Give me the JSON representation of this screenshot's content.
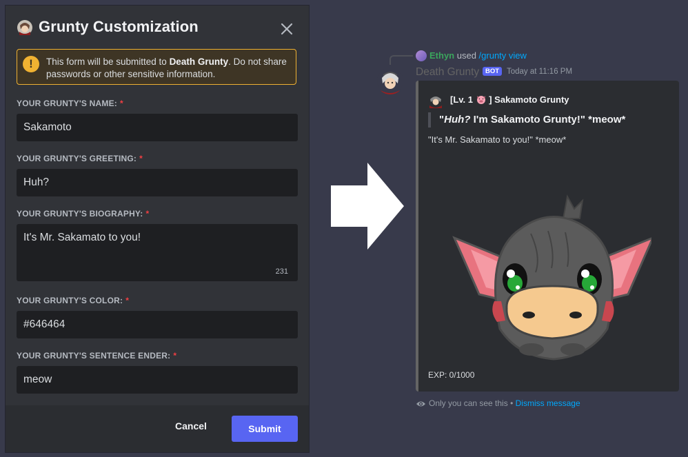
{
  "modal": {
    "title": "Grunty Customization",
    "warning_prefix": "This form will be submitted to ",
    "warning_bot": "Death Grunty",
    "warning_suffix": ". Do not share passwords or other sensitive information.",
    "fields": [
      {
        "label": "YOUR GRUNTY'S NAME:",
        "value": "Sakamoto"
      },
      {
        "label": "YOUR GRUNTY'S GREETING:",
        "value": "Huh?"
      },
      {
        "label": "YOUR GRUNTY'S BIOGRAPHY:",
        "value": "It's Mr. Sakamato to you!",
        "counter": "231"
      },
      {
        "label": "YOUR GRUNTY'S COLOR:",
        "value": "#646464"
      },
      {
        "label": "YOUR GRUNTY'S SENTENCE ENDER:",
        "value": "meow"
      }
    ],
    "required_mark": "*",
    "cancel_label": "Cancel",
    "submit_label": "Submit"
  },
  "message": {
    "reply_user": "Ethyn",
    "reply_used": " used ",
    "reply_command": "/grunty view",
    "author": "Death Grunty",
    "bot_tag": "BOT",
    "timestamp": "Today at 11:16 PM",
    "embed": {
      "color": "#646464",
      "author_prefix": "[Lv. 1 ",
      "author_suffix": "] Sakamoto Grunty",
      "quote_open": "\"",
      "quote_italic": "Huh?",
      "quote_rest": " I'm Sakamoto Grunty!\" *meow*",
      "description": "\"It's Mr. Sakamato to you!\" *meow*",
      "exp": "EXP: 0/1000"
    },
    "ephemeral_note": "Only you can see this",
    "ephemeral_sep": " • ",
    "dismiss_label": "Dismiss message"
  },
  "colors": {
    "accent": "#5865f2",
    "warning": "#f0b232",
    "embed_bar": "#646464",
    "link": "#00a8fc"
  },
  "icons": [
    "bot-avatar-icon",
    "close-icon",
    "warning-icon",
    "arrow-right-icon",
    "pig-icon",
    "eye-icon"
  ]
}
